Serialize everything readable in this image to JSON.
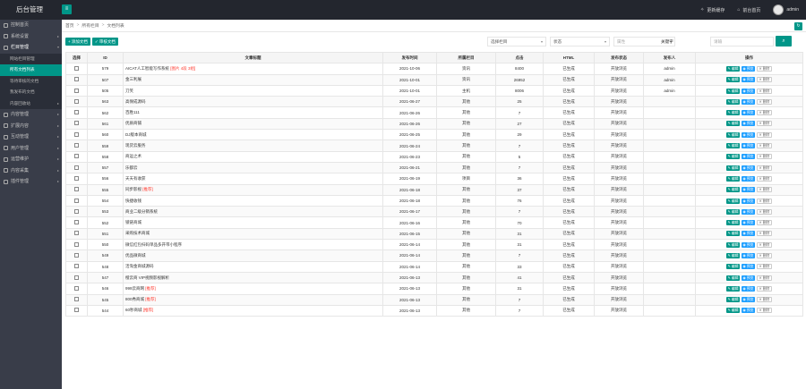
{
  "header": {
    "logo": "后台管理",
    "menu_toggle_icon": "≡",
    "links": [
      {
        "icon": "clear-cache-icon",
        "glyph": "✧",
        "label": "更新缓存"
      },
      {
        "icon": "home-icon",
        "glyph": "⌂",
        "label": "前台首页"
      }
    ],
    "user": "admin"
  },
  "sidebar": {
    "items": [
      {
        "label": "控制首页",
        "icon": "home-icon"
      },
      {
        "label": "系统设置",
        "icon": "gear-icon",
        "caret": "▸"
      },
      {
        "label": "栏目管理",
        "icon": "column-icon",
        "caret": "▾"
      },
      {
        "label": "内容管理",
        "icon": "content-icon",
        "caret": "▸"
      },
      {
        "label": "扩展内容",
        "icon": "extend-icon",
        "caret": "▸"
      },
      {
        "label": "互动管理",
        "icon": "chat-icon",
        "caret": "▸"
      },
      {
        "label": "用户管理",
        "icon": "user-icon",
        "caret": "▸"
      },
      {
        "label": "运营维护",
        "icon": "tools-icon",
        "caret": "▸"
      },
      {
        "label": "内容采集",
        "icon": "collect-icon",
        "caret": "▸"
      },
      {
        "label": "插件管理",
        "icon": "plugin-icon",
        "caret": "▸"
      }
    ],
    "subitems": [
      {
        "label": "网站栏目管理",
        "active": false
      },
      {
        "label": "所有文档列表",
        "active": true
      },
      {
        "label": "等待审核的文档",
        "active": false
      },
      {
        "label": "我发布的文档",
        "active": false
      },
      {
        "label": "内容回收站",
        "active": false,
        "caret": "▸"
      }
    ]
  },
  "breadcrumb": [
    "首页",
    "所有栏目",
    "文档列表"
  ],
  "toolbar": {
    "add_label": "+ 添加文档",
    "batch_label": "✓ 审核文档",
    "filter_channel": "选择栏目",
    "filter_status": "状态",
    "filter_attr": "属性",
    "keyword_label": "关键字",
    "keyword_placeholder": "请输",
    "search_icon": "⌕",
    "refresh_icon": "↻"
  },
  "table": {
    "columns": [
      "选择",
      "ID",
      "文章标题",
      "发布时间",
      "所属栏目",
      "点击",
      "HTML",
      "发布状态",
      "发布人",
      "操作"
    ],
    "op_labels": {
      "edit": "✎ 编辑",
      "view": "◉ 预览",
      "del": "✕ 删除"
    },
    "rows": [
      {
        "id": "579",
        "title": "AICAT人工智能写作系统",
        "tag": "[图片 4段 3组]",
        "date": "2021-10-06",
        "column": "资讯",
        "clicks": "8400",
        "html": "已生成",
        "status": "开放浏览",
        "author": "admin"
      },
      {
        "id": "507",
        "title": "金三利展",
        "tag": "",
        "date": "2021-10-01",
        "column": "资讯",
        "clicks": "26952",
        "html": "已生成",
        "status": "开放浏览",
        "author": "admin"
      },
      {
        "id": "505",
        "title": "刀笑",
        "tag": "",
        "date": "2021-10-01",
        "column": "主机",
        "clicks": "8006",
        "html": "已生成",
        "status": "开放浏览",
        "author": "admin"
      },
      {
        "id": "563",
        "title": "高保成源码",
        "tag": "",
        "date": "2021-06-27",
        "column": "其他",
        "clicks": "25",
        "html": "已生成",
        "status": "开放浏览",
        "author": ""
      },
      {
        "id": "562",
        "title": "百胜111",
        "tag": "",
        "date": "2021-06-26",
        "column": "其他",
        "clicks": "7",
        "html": "已生成",
        "status": "开放浏览",
        "author": ""
      },
      {
        "id": "561",
        "title": "优质商铺",
        "tag": "",
        "date": "2021-06-26",
        "column": "其他",
        "clicks": "27",
        "html": "已生成",
        "status": "开放浏览",
        "author": ""
      },
      {
        "id": "560",
        "title": "DJ版本商城",
        "tag": "",
        "date": "2021-06-25",
        "column": "其他",
        "clicks": "29",
        "html": "已生成",
        "status": "开放浏览",
        "author": ""
      },
      {
        "id": "559",
        "title": "现货云服务",
        "tag": "",
        "date": "2021-06-24",
        "column": "其他",
        "clicks": "7",
        "html": "已生成",
        "status": "开放浏览",
        "author": ""
      },
      {
        "id": "558",
        "title": "商运之术",
        "tag": "",
        "date": "2021-06-23",
        "column": "其他",
        "clicks": "5",
        "html": "已生成",
        "status": "开放浏览",
        "author": ""
      },
      {
        "id": "557",
        "title": "乐都云",
        "tag": "",
        "date": "2021-06-21",
        "column": "其他",
        "clicks": "7",
        "html": "已生成",
        "status": "开放浏览",
        "author": ""
      },
      {
        "id": "556",
        "title": "天天有收获",
        "tag": "",
        "date": "2021-06-19",
        "column": "项目",
        "clicks": "36",
        "html": "已生成",
        "status": "开放浏览",
        "author": ""
      },
      {
        "id": "555",
        "title": "同步影视",
        "tag": "[推荐]",
        "date": "2021-06-18",
        "column": "其他",
        "clicks": "37",
        "html": "已生成",
        "status": "开放浏览",
        "author": ""
      },
      {
        "id": "554",
        "title": "快捷收钱",
        "tag": "",
        "date": "2021-06-18",
        "column": "其他",
        "clicks": "76",
        "html": "已生成",
        "status": "开放浏览",
        "author": ""
      },
      {
        "id": "553",
        "title": "商业二级分销系统",
        "tag": "",
        "date": "2021-06-17",
        "column": "其他",
        "clicks": "7",
        "html": "已生成",
        "status": "开放浏览",
        "author": ""
      },
      {
        "id": "552",
        "title": "锁链商城",
        "tag": "",
        "date": "2021-06-16",
        "column": "其他",
        "clicks": "70",
        "html": "已生成",
        "status": "开放浏览",
        "author": ""
      },
      {
        "id": "551",
        "title": "采购技术商城",
        "tag": "",
        "date": "2021-06-15",
        "column": "其他",
        "clicks": "31",
        "html": "已生成",
        "status": "开放浏览",
        "author": ""
      },
      {
        "id": "550",
        "title": "微信红包扫码单品多开带小程序",
        "tag": "",
        "date": "2021-06-14",
        "column": "其他",
        "clicks": "31",
        "html": "已生成",
        "status": "开放浏览",
        "author": ""
      },
      {
        "id": "549",
        "title": "优品微商城",
        "tag": "",
        "date": "2021-06-14",
        "column": "其他",
        "clicks": "7",
        "html": "已生成",
        "status": "开放浏览",
        "author": ""
      },
      {
        "id": "548",
        "title": "活淘金商城源码",
        "tag": "",
        "date": "2021-06-14",
        "column": "其他",
        "clicks": "33",
        "html": "已生成",
        "status": "开放浏览",
        "author": ""
      },
      {
        "id": "547",
        "title": "橙云商 VIP视频影视解析",
        "tag": "",
        "date": "2021-06-13",
        "column": "其他",
        "clicks": "41",
        "html": "已生成",
        "status": "开放浏览",
        "author": ""
      },
      {
        "id": "546",
        "title": "999云商网",
        "tag": "[推荐]",
        "date": "2021-06-13",
        "column": "其他",
        "clicks": "31",
        "html": "已生成",
        "status": "开放浏览",
        "author": ""
      },
      {
        "id": "545",
        "title": "800秀商城",
        "tag": "[推荐]",
        "date": "2021-06-13",
        "column": "其他",
        "clicks": "7",
        "html": "已生成",
        "status": "开放浏览",
        "author": ""
      },
      {
        "id": "544",
        "title": "60秒商城",
        "tag": "[推荐]",
        "date": "2021-06-13",
        "column": "其他",
        "clicks": "7",
        "html": "已生成",
        "status": "开放浏览",
        "author": ""
      }
    ]
  }
}
